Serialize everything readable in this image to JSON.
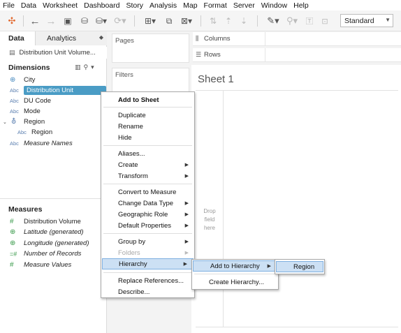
{
  "menubar": [
    "File",
    "Data",
    "Worksheet",
    "Dashboard",
    "Story",
    "Analysis",
    "Map",
    "Format",
    "Server",
    "Window",
    "Help"
  ],
  "toolbar": {
    "icons": [
      "tableau-logo-icon",
      "back-icon",
      "forward-icon",
      "save-icon",
      "new-datasource-icon",
      "pause-updates-icon",
      "refresh-icon",
      "new-worksheet-icon",
      "duplicate-icon",
      "clear-icon",
      "swap-icon",
      "sort-ascending-icon",
      "sort-descending-icon",
      "group-icon",
      "labels-icon",
      "highlight-icon",
      "tooltip-icon",
      "fit-icon",
      "pin-icon"
    ],
    "view_select": "Standard"
  },
  "left_panel": {
    "tabs": [
      "Data",
      "Analytics"
    ],
    "datasource": "Distribution Unit Volume...",
    "dimensions_header": "Dimensions",
    "dimensions": [
      {
        "type": "globe",
        "type_label": "",
        "name": "City",
        "italic": false,
        "indent": false,
        "selected": false
      },
      {
        "type": "abc",
        "type_label": "Abc",
        "name": "Distribution Unit",
        "italic": false,
        "indent": false,
        "selected": true
      },
      {
        "type": "abc",
        "type_label": "Abc",
        "name": "DU Code",
        "italic": false,
        "indent": false,
        "selected": false
      },
      {
        "type": "abc",
        "type_label": "Abc",
        "name": "Mode",
        "italic": false,
        "indent": false,
        "selected": false
      },
      {
        "type": "hierarchy",
        "type_label": "",
        "name": "Region",
        "italic": false,
        "indent": false,
        "selected": false
      },
      {
        "type": "abc",
        "type_label": "Abc",
        "name": "Region",
        "italic": false,
        "indent": true,
        "selected": false
      },
      {
        "type": "abc",
        "type_label": "Abc",
        "name": "Measure Names",
        "italic": true,
        "indent": false,
        "selected": false
      }
    ],
    "measures_header": "Measures",
    "measures": [
      {
        "type_label": "#",
        "name": "Distribution Volume",
        "italic": false
      },
      {
        "type_label": "globe",
        "name": "Latitude (generated)",
        "italic": true
      },
      {
        "type_label": "globe",
        "name": "Longitude (generated)",
        "italic": true
      },
      {
        "type_label": "=#",
        "name": "Number of Records",
        "italic": true
      },
      {
        "type_label": "#",
        "name": "Measure Values",
        "italic": true
      }
    ]
  },
  "cards": {
    "pages": "Pages",
    "filters": "Filters"
  },
  "shelves": {
    "columns": "Columns",
    "rows": "Rows"
  },
  "sheet": {
    "title": "Sheet 1",
    "drop_hint": "Drop field here"
  },
  "context_menu": {
    "items": [
      {
        "label": "Add to Sheet",
        "bold": true,
        "submenu": false,
        "disabled": false,
        "highlighted": false
      },
      {
        "separator": true
      },
      {
        "label": "Duplicate",
        "submenu": false,
        "disabled": false,
        "highlighted": false
      },
      {
        "label": "Rename",
        "submenu": false,
        "disabled": false,
        "highlighted": false
      },
      {
        "label": "Hide",
        "submenu": false,
        "disabled": false,
        "highlighted": false
      },
      {
        "separator": true
      },
      {
        "label": "Aliases...",
        "submenu": false,
        "disabled": false,
        "highlighted": false
      },
      {
        "label": "Create",
        "submenu": true,
        "disabled": false,
        "highlighted": false
      },
      {
        "label": "Transform",
        "submenu": true,
        "disabled": false,
        "highlighted": false
      },
      {
        "separator": true
      },
      {
        "label": "Convert to Measure",
        "submenu": false,
        "disabled": false,
        "highlighted": false
      },
      {
        "label": "Change Data Type",
        "submenu": true,
        "disabled": false,
        "highlighted": false
      },
      {
        "label": "Geographic Role",
        "submenu": true,
        "disabled": false,
        "highlighted": false
      },
      {
        "label": "Default Properties",
        "submenu": true,
        "disabled": false,
        "highlighted": false
      },
      {
        "separator": true
      },
      {
        "label": "Group by",
        "submenu": true,
        "disabled": false,
        "highlighted": false
      },
      {
        "label": "Folders",
        "submenu": true,
        "disabled": true,
        "highlighted": false
      },
      {
        "label": "Hierarchy",
        "submenu": true,
        "disabled": false,
        "highlighted": true
      },
      {
        "separator": true
      },
      {
        "label": "Replace References...",
        "submenu": false,
        "disabled": false,
        "highlighted": false
      },
      {
        "label": "Describe...",
        "submenu": false,
        "disabled": false,
        "highlighted": false
      }
    ]
  },
  "hierarchy_submenu": {
    "items": [
      {
        "label": "Add to Hierarchy",
        "submenu": true,
        "highlighted": true
      },
      {
        "separator": true
      },
      {
        "label": "Create Hierarchy...",
        "submenu": false,
        "highlighted": false
      }
    ]
  },
  "add_to_hierarchy_submenu": {
    "items": [
      {
        "label": "Region",
        "highlighted": true
      }
    ]
  }
}
